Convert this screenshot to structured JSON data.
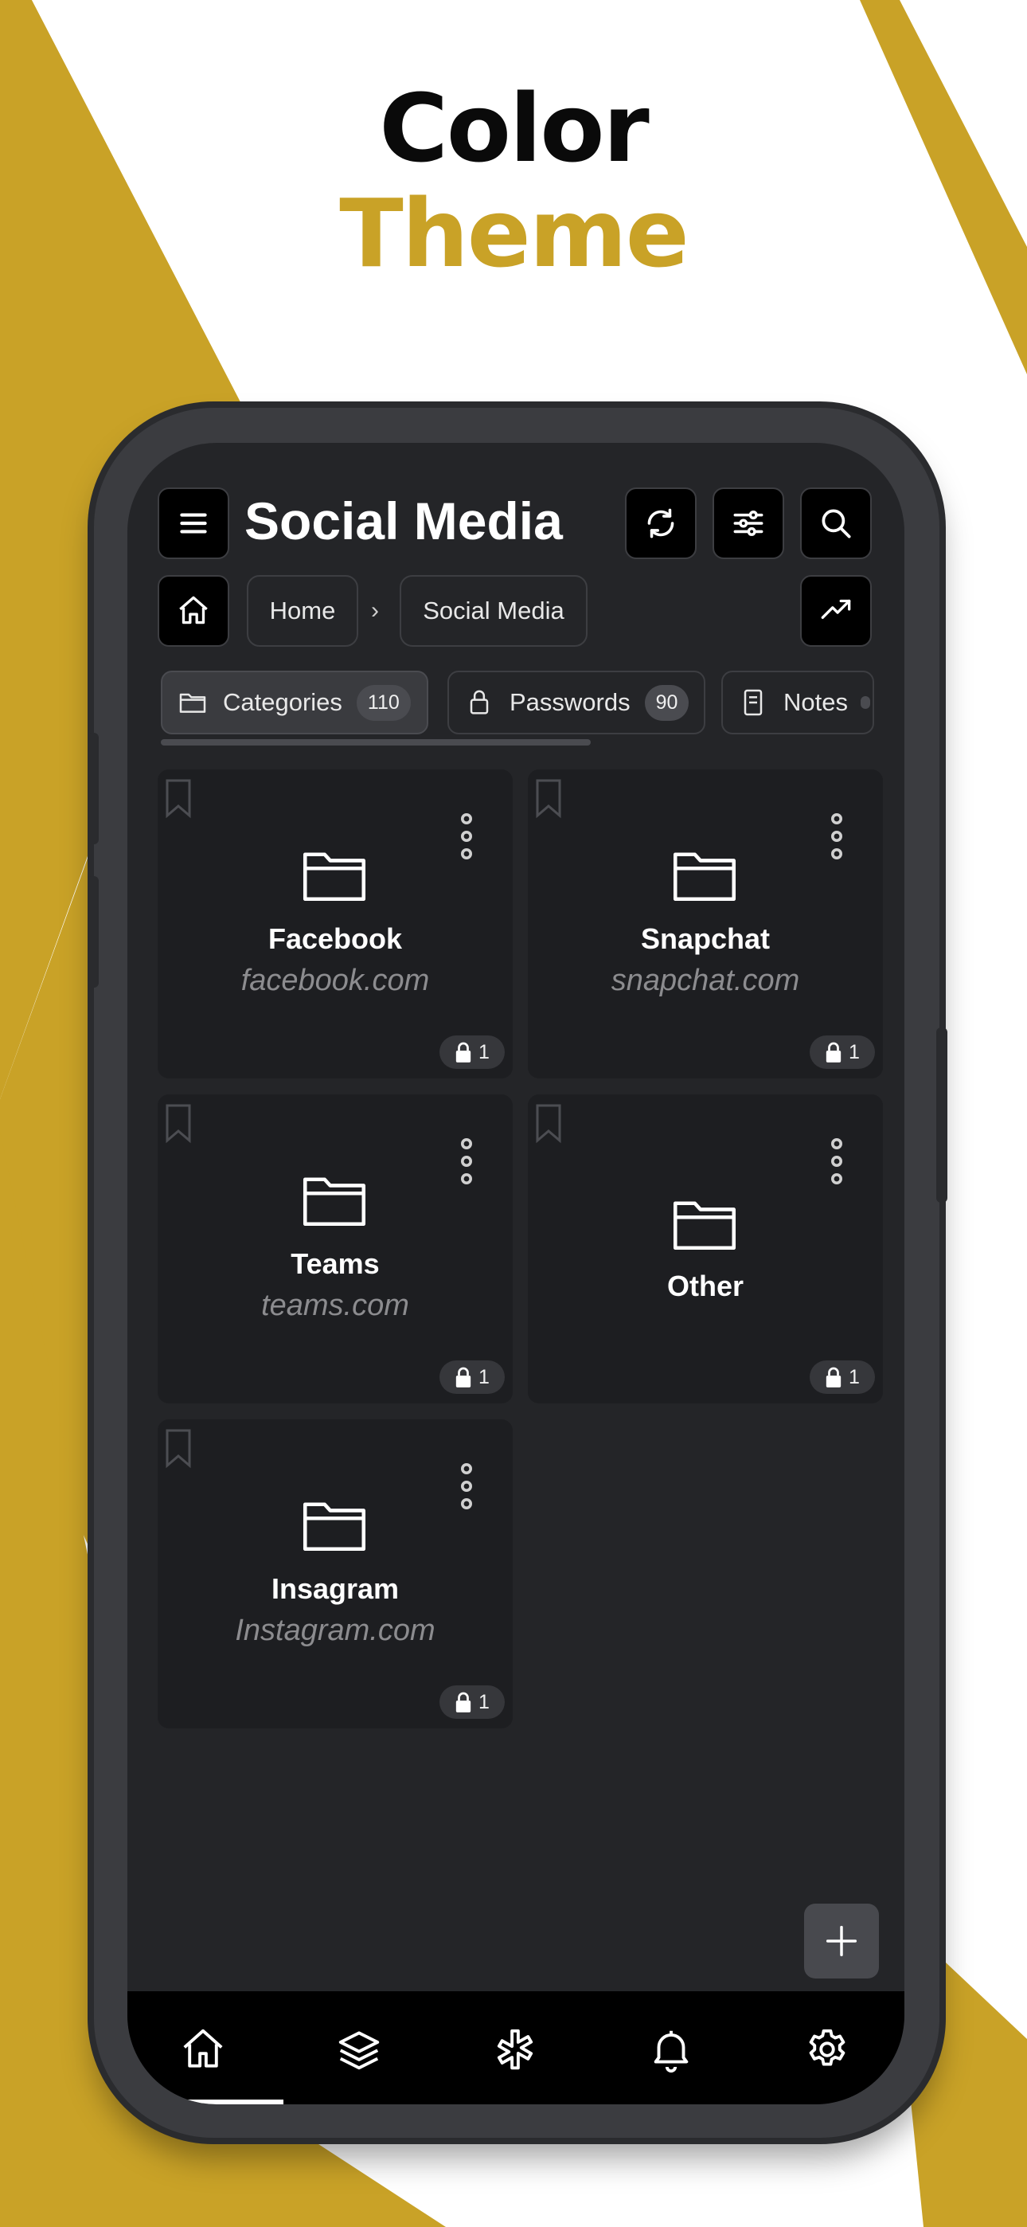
{
  "colors": {
    "accent": "#c9a227",
    "screen_bg": "#242528",
    "card_bg": "#1d1e21",
    "bar_bg": "#000000"
  },
  "promo": {
    "line1": "Color",
    "line2": "Theme"
  },
  "header": {
    "title": "Social Media",
    "menu_icon": "menu-icon",
    "action_icons": [
      "sync-icon",
      "sliders-icon",
      "search-icon"
    ]
  },
  "breadcrumb": {
    "home": "Home",
    "separator": "›",
    "current": "Social Media"
  },
  "tabs": [
    {
      "label": "Categories",
      "count": "110",
      "icon": "folder-icon",
      "active": true
    },
    {
      "label": "Passwords",
      "count": "90",
      "icon": "lock-icon",
      "active": false
    },
    {
      "label": "Notes",
      "count": "",
      "icon": "note-icon",
      "active": false
    }
  ],
  "cards": [
    {
      "name": "Facebook",
      "domain": "facebook.com",
      "locks": "1"
    },
    {
      "name": "Snapchat",
      "domain": "snapchat.com",
      "locks": "1"
    },
    {
      "name": "Teams",
      "domain": "teams.com",
      "locks": "1"
    },
    {
      "name": "Other",
      "domain": "",
      "locks": "1"
    },
    {
      "name": "Insagram",
      "domain": "Instagram.com",
      "locks": "1"
    }
  ],
  "fab": {
    "icon": "plus-icon"
  },
  "bottom_nav": {
    "items": [
      "home-icon",
      "layers-icon",
      "asterisk-icon",
      "bell-icon",
      "gear-icon"
    ],
    "active": "home-icon"
  }
}
